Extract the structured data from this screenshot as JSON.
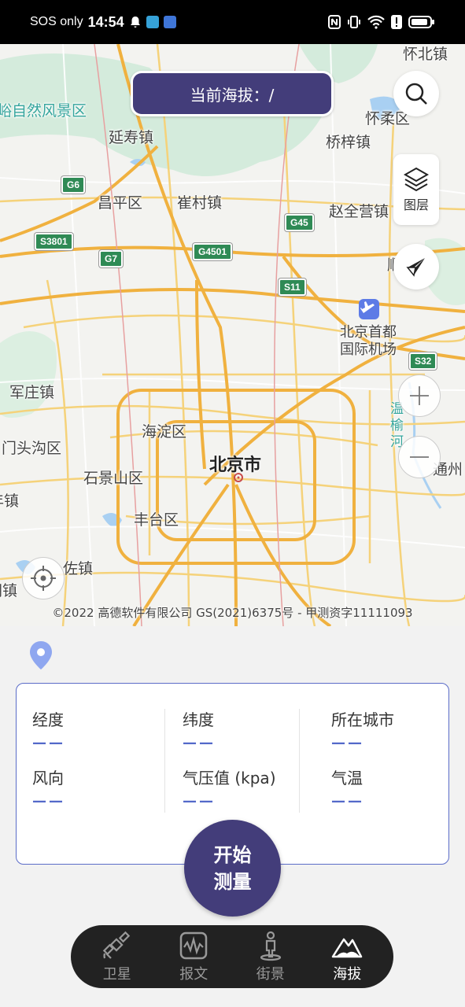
{
  "status_bar": {
    "carrier": "SOS only",
    "time": "14:54"
  },
  "map": {
    "altitude_label": "当前海拔：/",
    "layer_label": "图层",
    "copyright": "©2022 高德软件有限公司 GS(2021)6375号 - 甲测资字11111093",
    "places": {
      "huaibei": "怀北镇",
      "scenic": "峪自然风景区",
      "yanshou": "延寿镇",
      "huairou": "怀柔区",
      "qiaozi": "桥梓镇",
      "changping": "昌平区",
      "cuicun": "崔村镇",
      "zhaoquanying": "赵全营镇",
      "shun": "顺",
      "airport": "北京首都\n国际机场",
      "junzhuang": "军庄镇",
      "haidian": "海淀区",
      "mentougou": "门头沟区",
      "beijing": "北京市",
      "shijingshan": "石景山区",
      "tongzhou": "通州",
      "wenyu": "温\n榆\n河",
      "fengtai": "丰台区",
      "zhen_left": "年镇",
      "zuo": "佐镇",
      "hu": "胡镇"
    },
    "shields": {
      "g6": "G6",
      "s3801": "S3801",
      "g7": "G7",
      "g4501": "G4501",
      "g45": "G45",
      "s11": "S11",
      "s32": "S32"
    }
  },
  "info": {
    "longitude_label": "经度",
    "longitude_value": "——",
    "latitude_label": "纬度",
    "latitude_value": "——",
    "city_label": "所在城市",
    "city_value": "——",
    "wind_label": "风向",
    "wind_value": "——",
    "pressure_label": "气压值 (kpa)",
    "pressure_value": "——",
    "temperature_label": "气温",
    "temperature_value": "——"
  },
  "start_button": {
    "label": "开始测量"
  },
  "bottom_nav": {
    "items": [
      {
        "label": "卫星",
        "icon": "satellite-icon"
      },
      {
        "label": "报文",
        "icon": "waveform-icon"
      },
      {
        "label": "街景",
        "icon": "street-view-icon"
      },
      {
        "label": "海拔",
        "icon": "mountain-icon",
        "active": true
      }
    ]
  },
  "colors": {
    "accent": "#433d7a",
    "value_blue": "#5469c9",
    "card_border": "#5b6cc8"
  }
}
